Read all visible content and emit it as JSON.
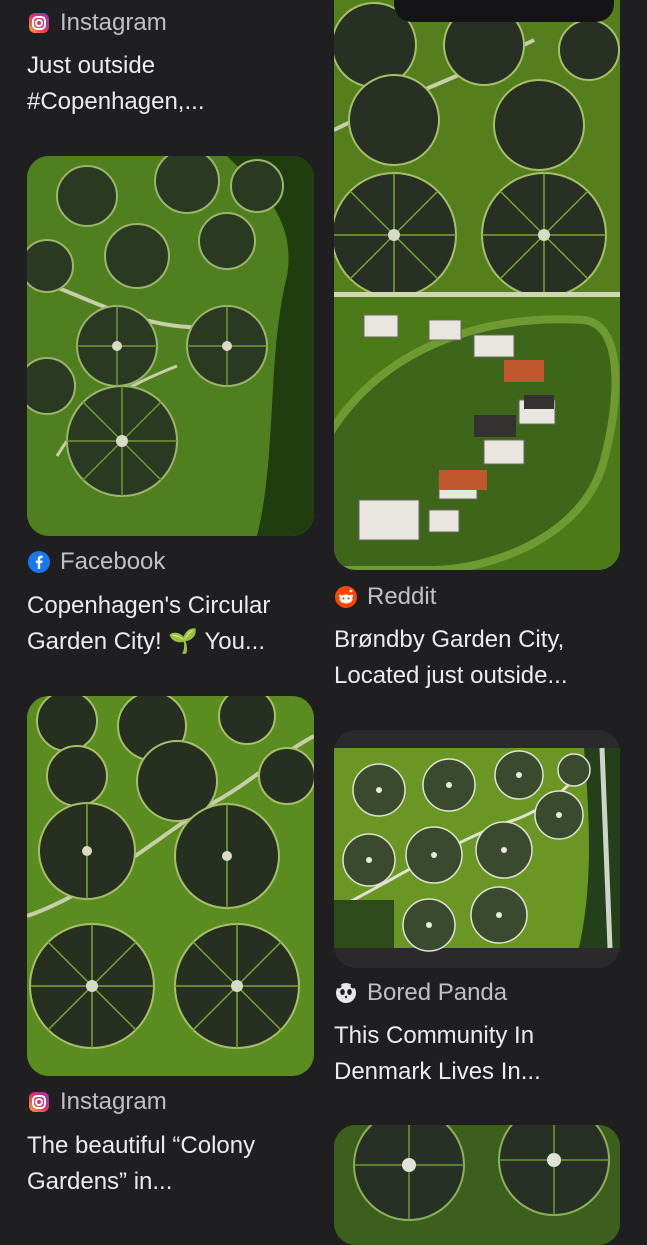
{
  "results": {
    "left": [
      {
        "source": "Instagram",
        "source_icon": "instagram-icon",
        "title": "Just outside\n#Copenhagen,..."
      },
      {
        "source": "Facebook",
        "source_icon": "facebook-icon",
        "title": "Copenhagen's Circular\nGarden City! 🌱 You...",
        "image": "aerial-circular-gardens"
      },
      {
        "source": "Instagram",
        "source_icon": "instagram-icon",
        "title": "The beautiful “Colony\nGardens” in...",
        "image": "aerial-circular-gardens"
      }
    ],
    "right": [
      {
        "source": "Reddit",
        "source_icon": "reddit-icon",
        "title": "Brøndby Garden City,\nLocated just outside...",
        "image": "aerial-circular-gardens"
      },
      {
        "source": "Bored Panda",
        "source_icon": "bored-panda-icon",
        "title": "This Community In\nDenmark Lives In...",
        "image": "aerial-circular-gardens"
      },
      {
        "image": "aerial-circular-gardens"
      }
    ]
  },
  "colors": {
    "background": "#1f1f22",
    "text": "#ececee",
    "source_text": "#bfc1c6",
    "instagram": "#e1306c",
    "facebook": "#1877f2",
    "reddit": "#ff4500"
  }
}
